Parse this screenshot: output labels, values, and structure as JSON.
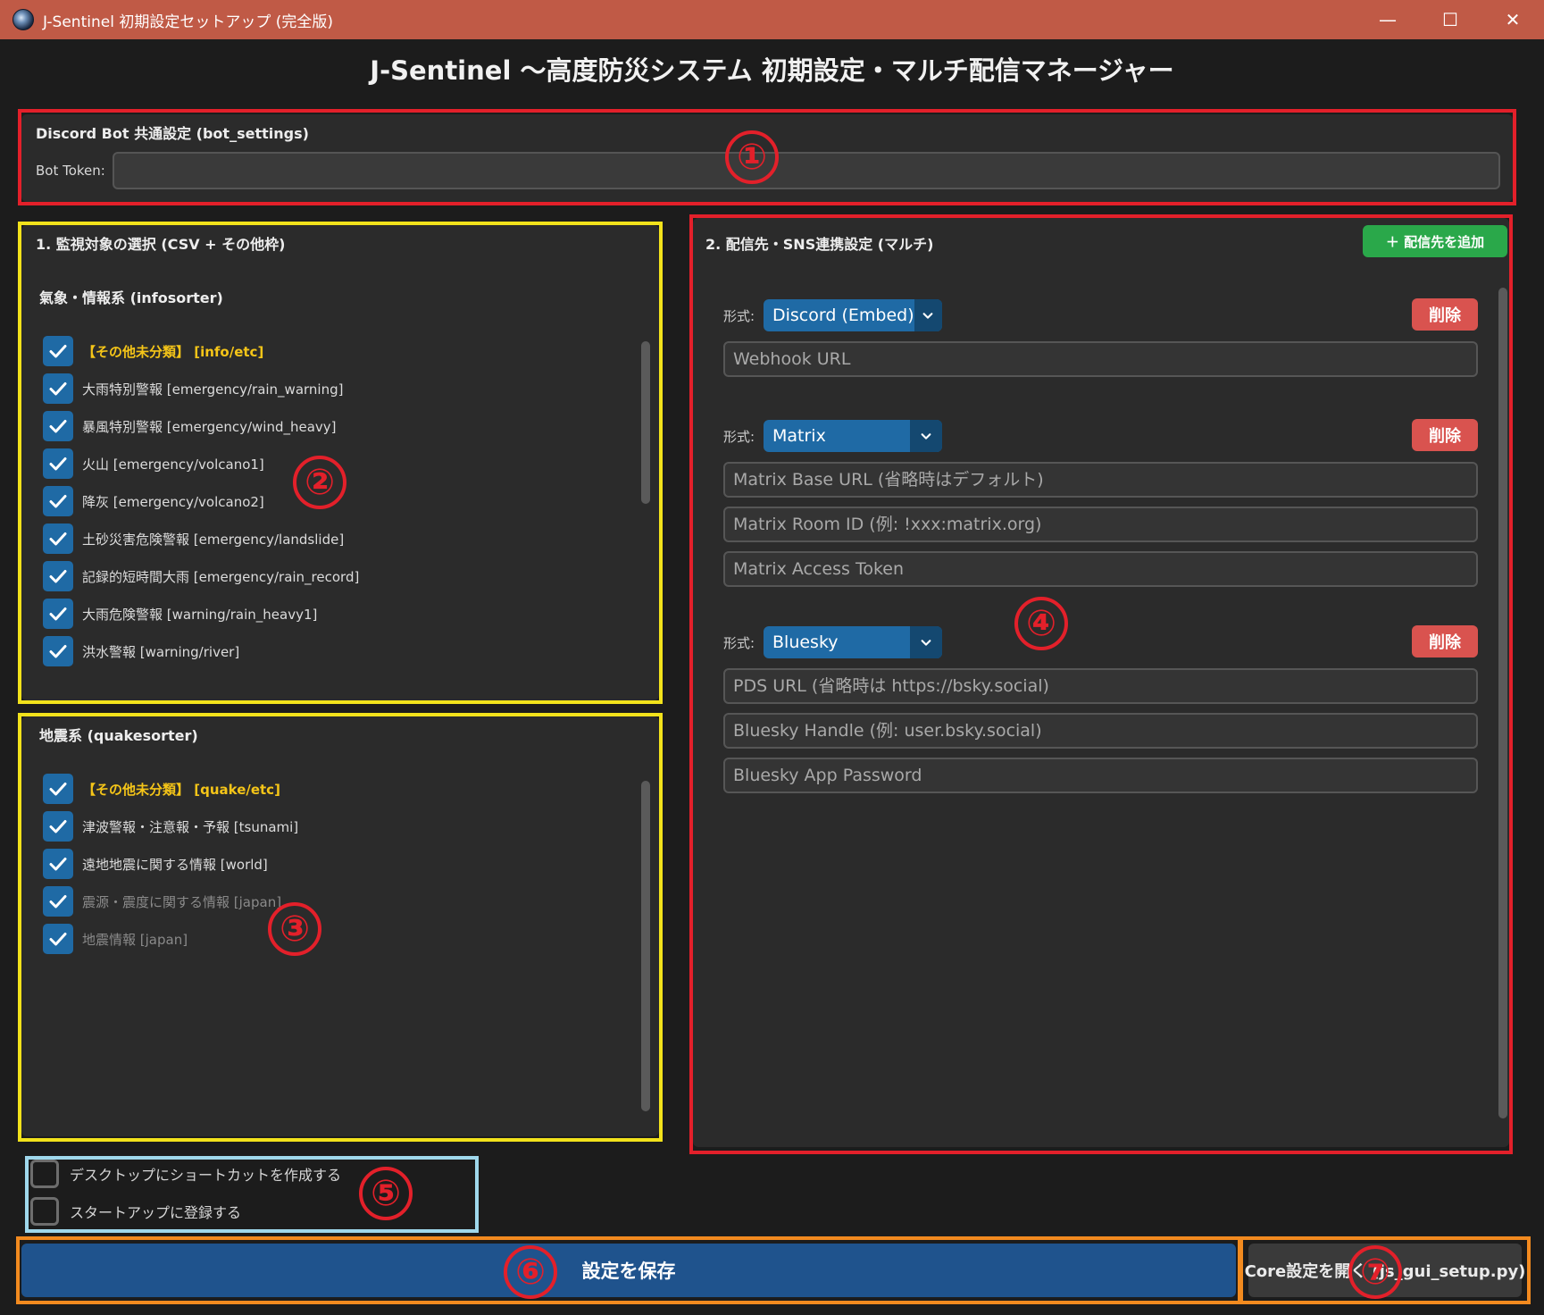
{
  "window": {
    "title": "J-Sentinel 初期設定セットアップ (完全版)",
    "controls": {
      "minimize": "—",
      "maximize": "☐",
      "close": "✕"
    }
  },
  "header": {
    "title": "J-Sentinel 〜高度防災システム 初期設定・マルチ配信マネージャー"
  },
  "bot_settings": {
    "section_title": "Discord Bot 共通設定 (bot_settings)",
    "token_label": "Bot Token:",
    "token_value": ""
  },
  "monitoring": {
    "section_title": "1. 監視対象の選択 (CSV + その他枠)",
    "info_group": {
      "title": "氣象・情報系 (infosorter)",
      "items": [
        {
          "label": "【その他未分類】 [info/etc]",
          "checked": true,
          "style": "hi"
        },
        {
          "label": "大雨特別警報 [emergency/rain_warning]",
          "checked": true,
          "style": ""
        },
        {
          "label": "暴風特別警報 [emergency/wind_heavy]",
          "checked": true,
          "style": ""
        },
        {
          "label": "火山 [emergency/volcano1]",
          "checked": true,
          "style": ""
        },
        {
          "label": "降灰 [emergency/volcano2]",
          "checked": true,
          "style": ""
        },
        {
          "label": "土砂災害危険警報 [emergency/landslide]",
          "checked": true,
          "style": ""
        },
        {
          "label": "記録的短時間大雨 [emergency/rain_record]",
          "checked": true,
          "style": ""
        },
        {
          "label": "大雨危険警報 [warning/rain_heavy1]",
          "checked": true,
          "style": ""
        },
        {
          "label": "洪水警報 [warning/river]",
          "checked": true,
          "style": ""
        }
      ]
    },
    "quake_group": {
      "title": "地震系 (quakesorter)",
      "items": [
        {
          "label": "【その他未分類】 [quake/etc]",
          "checked": true,
          "style": "hi"
        },
        {
          "label": "津波警報・注意報・予報 [tsunami]",
          "checked": true,
          "style": ""
        },
        {
          "label": "遠地地震に関する情報 [world]",
          "checked": true,
          "style": ""
        },
        {
          "label": "震源・震度に関する情報 [japan]",
          "checked": true,
          "style": "dim"
        },
        {
          "label": "地震情報 [japan]",
          "checked": true,
          "style": "dim"
        }
      ]
    }
  },
  "destinations": {
    "section_title": "2. 配信先・SNS連携設定 (マルチ)",
    "add_button": "＋ 配信先を追加",
    "format_label": "形式:",
    "delete_label": "削除",
    "entries": [
      {
        "format": "Discord (Embed)",
        "fields": [
          {
            "placeholder": "Webhook URL",
            "value": ""
          }
        ]
      },
      {
        "format": "Matrix",
        "fields": [
          {
            "placeholder": "Matrix Base URL (省略時はデフォルト)",
            "value": ""
          },
          {
            "placeholder": "Matrix Room ID (例: !xxx:matrix.org)",
            "value": ""
          },
          {
            "placeholder": "Matrix Access Token",
            "value": ""
          }
        ]
      },
      {
        "format": "Bluesky",
        "fields": [
          {
            "placeholder": "PDS URL (省略時は https://bsky.social)",
            "value": ""
          },
          {
            "placeholder": "Bluesky Handle (例: user.bsky.social)",
            "value": ""
          },
          {
            "placeholder": "Bluesky App Password",
            "value": ""
          }
        ]
      }
    ]
  },
  "options": {
    "shortcut": {
      "label": "デスクトップにショートカットを作成する",
      "checked": false
    },
    "startup": {
      "label": "スタートアップに登録する",
      "checked": false
    }
  },
  "footer": {
    "save_button": "設定を保存",
    "core_button": "Core設定を開く (js_gui_setup.py)"
  },
  "annotations": {
    "m1": "①",
    "m2": "②",
    "m3": "③",
    "m4": "④",
    "m5": "⑤",
    "m6": "⑥",
    "m7": "⑦"
  },
  "colors": {
    "accent": "#1f6aa5",
    "titlebar": "#c05a46",
    "add": "#2aa84a",
    "delete": "#d9534f",
    "highlight": "#f5c518"
  }
}
